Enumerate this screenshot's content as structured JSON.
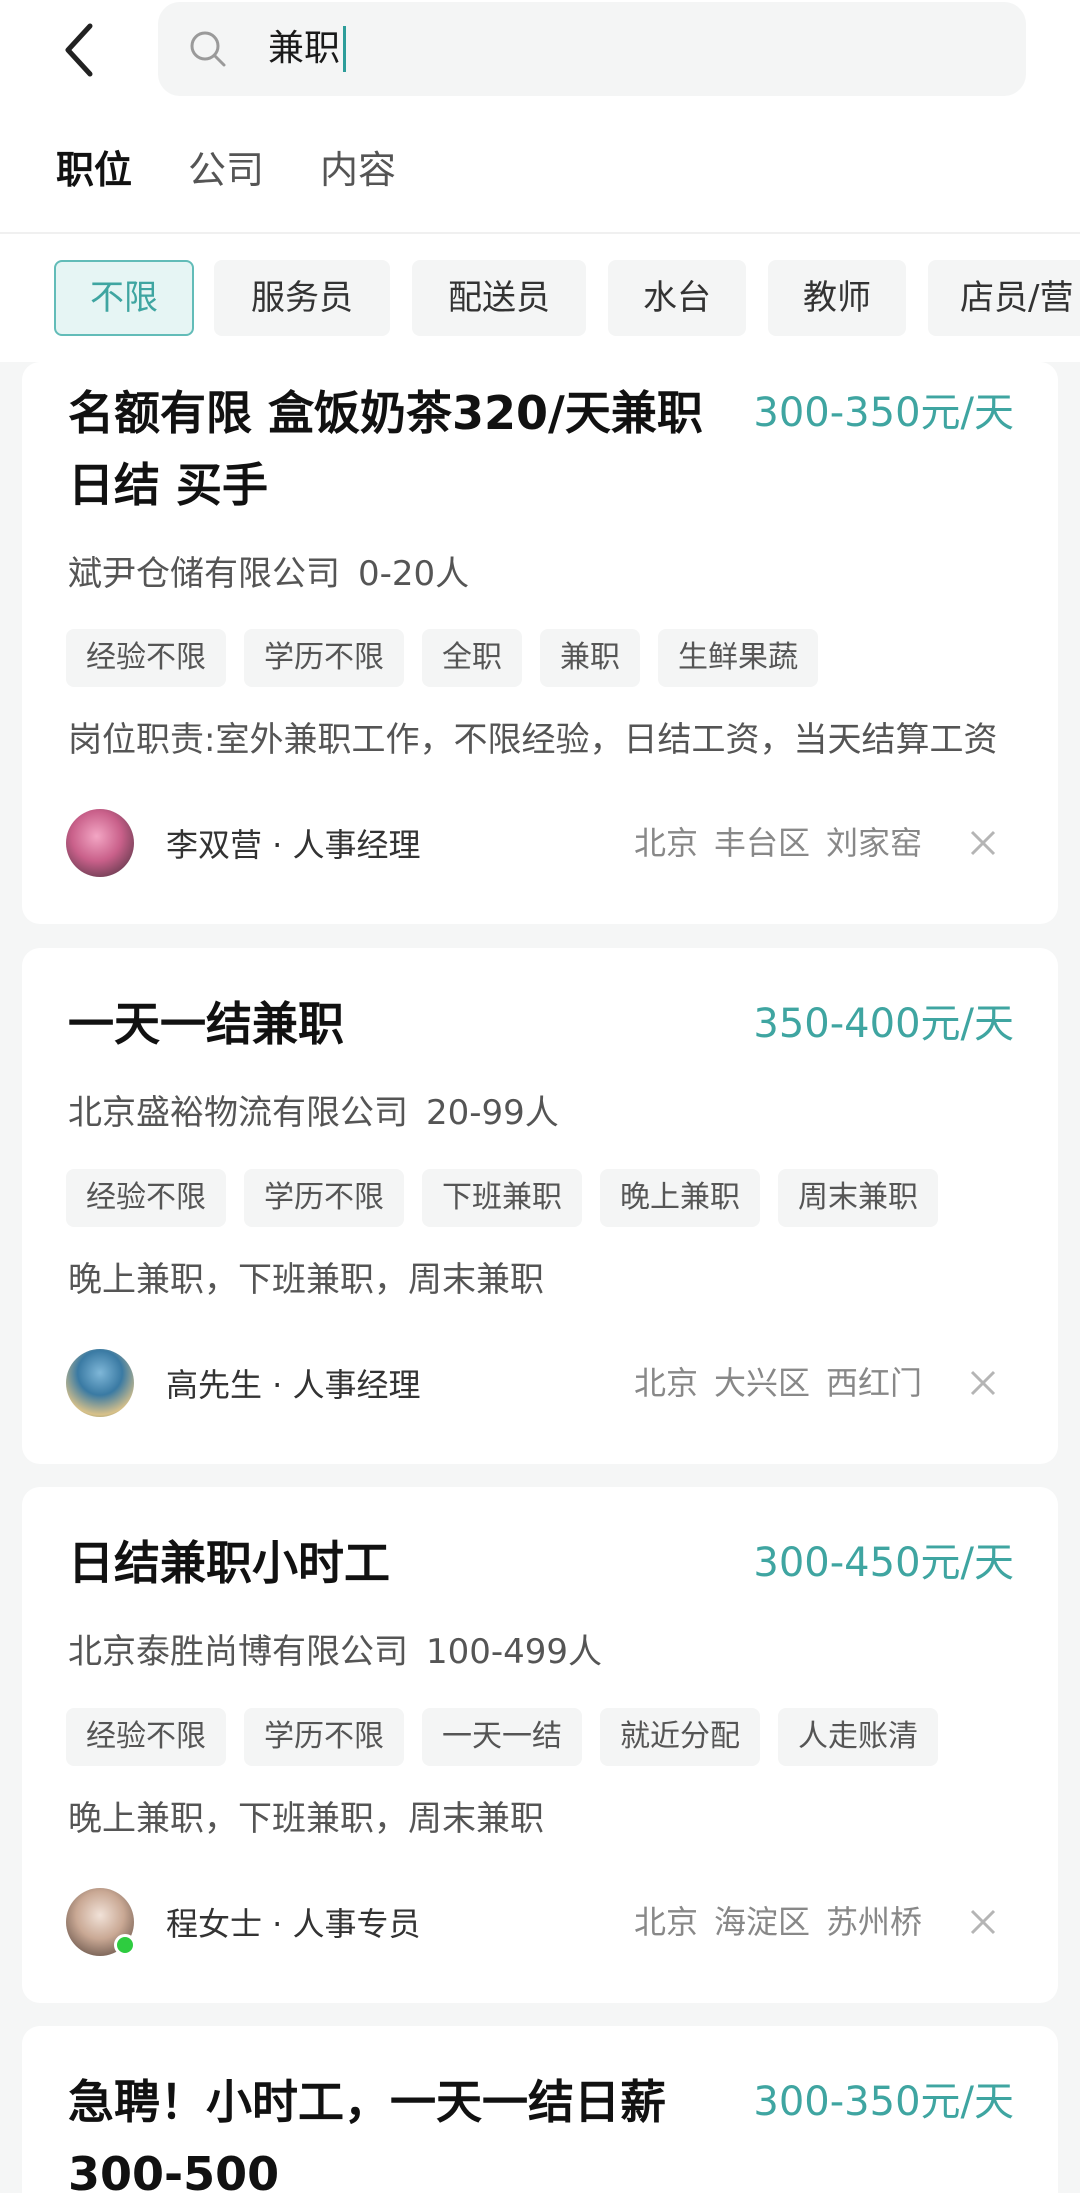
{
  "search": {
    "query": "兼职"
  },
  "tabs": [
    {
      "label": "职位",
      "active": true
    },
    {
      "label": "公司",
      "active": false
    },
    {
      "label": "内容",
      "active": false
    }
  ],
  "filters": [
    "不限",
    "服务员",
    "配送员",
    "水台",
    "教师",
    "店员/营"
  ],
  "jobs": [
    {
      "title": "名额有限 盒饭奶茶320/天兼职日结 买手",
      "salary": "300-350元/天",
      "company": "斌尹仓储有限公司",
      "company_size": "0-20人",
      "tags": [
        "经验不限",
        "学历不限",
        "全职",
        "兼职",
        "生鲜果蔬"
      ],
      "description": "岗位职责:室外兼职工作，不限经验，日结工资，当天结算工资",
      "recruiter": "李双营 · 人事经理",
      "city": "北京",
      "district": "丰台区",
      "area": "刘家窑"
    },
    {
      "title": "一天一结兼职",
      "salary": "350-400元/天",
      "company": "北京盛裕物流有限公司",
      "company_size": "20-99人",
      "tags": [
        "经验不限",
        "学历不限",
        "下班兼职",
        "晚上兼职",
        "周末兼职"
      ],
      "description": "晚上兼职，下班兼职，周末兼职",
      "recruiter": "高先生 · 人事经理",
      "city": "北京",
      "district": "大兴区",
      "area": "西红门"
    },
    {
      "title": "日结兼职小时工",
      "salary": "300-450元/天",
      "company": "北京泰胜尚博有限公司",
      "company_size": "100-499人",
      "tags": [
        "经验不限",
        "学历不限",
        "一天一结",
        "就近分配",
        "人走账清"
      ],
      "description": "晚上兼职，下班兼职，周末兼职",
      "recruiter": "程女士 · 人事专员",
      "city": "北京",
      "district": "海淀区",
      "area": "苏州桥"
    },
    {
      "title": "急聘！小时工，一天一结日薪300-500",
      "salary": "300-350元/天"
    }
  ],
  "colors": {
    "accent": "#3fa5a1",
    "online": "#2ecc40"
  }
}
